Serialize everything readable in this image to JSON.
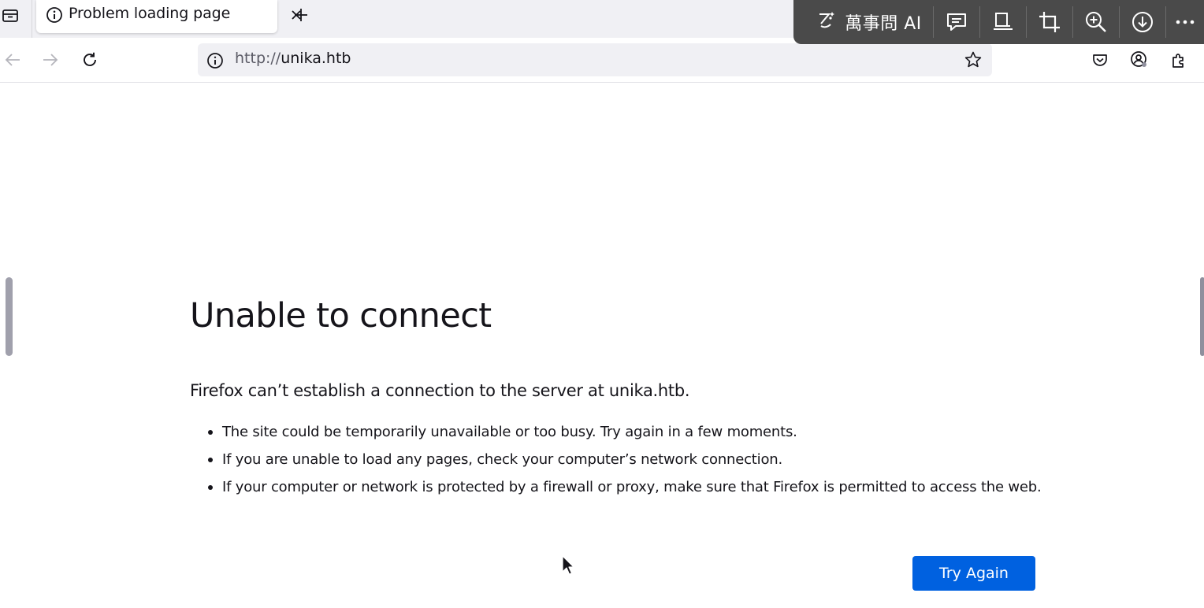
{
  "tab": {
    "title": "Problem loading page",
    "close_label": "×",
    "new_tab_label": "+"
  },
  "urlbar": {
    "scheme": "http://",
    "host": "unika.htb"
  },
  "ai_toolbar": {
    "label": "萬事問 AI",
    "icons": [
      "ai-sparkle-icon",
      "comment-icon",
      "bookmark-panel-icon",
      "crop-icon",
      "zoom-in-icon",
      "download-icon",
      "more-icon"
    ]
  },
  "error": {
    "title": "Unable to connect",
    "description": "Firefox can’t establish a connection to the server at unika.htb.",
    "items": [
      "The site could be temporarily unavailable or too busy. Try again in a few moments.",
      "If you are unable to load any pages, check your computer’s network connection.",
      "If your computer or network is protected by a firewall or proxy, make sure that Firefox is permitted to access the web."
    ],
    "button": "Try Again"
  },
  "colors": {
    "accent": "#0061e0",
    "tabstrip_bg": "#f0f0f4",
    "overlay_bg": "#4a4a4a"
  }
}
